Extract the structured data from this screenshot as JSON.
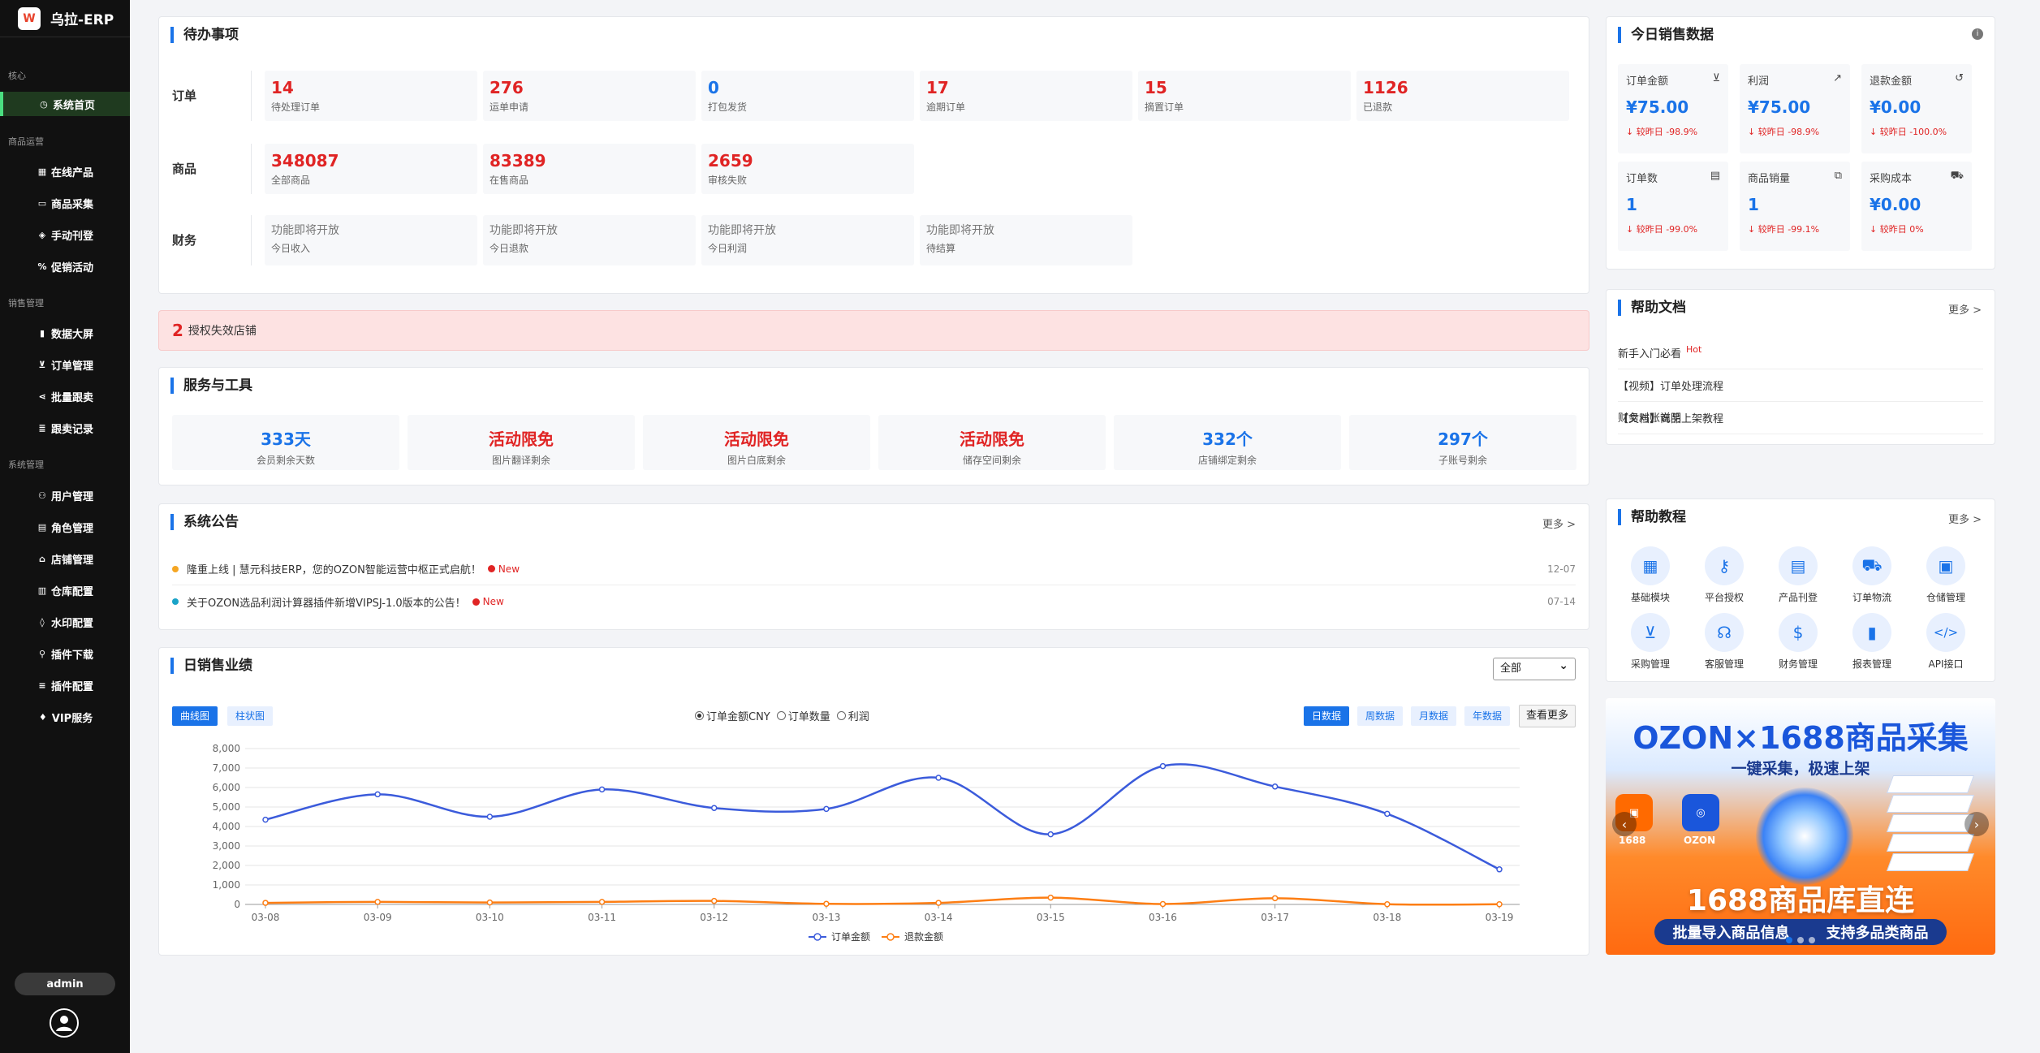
{
  "app": {
    "logo_text": "W",
    "title": "乌拉-ERP"
  },
  "nav": {
    "sections": [
      {
        "label": "核心"
      },
      {
        "label": "商品运营"
      },
      {
        "label": "销售管理"
      },
      {
        "label": "系统管理"
      }
    ],
    "items": [
      {
        "label": "系统首页",
        "icon": "dashboard-icon",
        "glyph": "◷"
      },
      {
        "label": "在线产品",
        "icon": "grid-icon",
        "glyph": "▦"
      },
      {
        "label": "商品采集",
        "icon": "box-icon",
        "glyph": "▭"
      },
      {
        "label": "手动刊登",
        "icon": "upload-icon",
        "glyph": "◈"
      },
      {
        "label": "促销活动",
        "icon": "percent-icon",
        "glyph": "%"
      },
      {
        "label": "数据大屏",
        "icon": "chart-bars-icon",
        "glyph": "▮"
      },
      {
        "label": "订单管理",
        "icon": "cart-icon",
        "glyph": "⊻"
      },
      {
        "label": "批量跟卖",
        "icon": "share-icon",
        "glyph": "⋖"
      },
      {
        "label": "跟卖记录",
        "icon": "list-icon",
        "glyph": "≣"
      },
      {
        "label": "用户管理",
        "icon": "users-icon",
        "glyph": "⚇"
      },
      {
        "label": "角色管理",
        "icon": "id-card-icon",
        "glyph": "▤"
      },
      {
        "label": "店铺管理",
        "icon": "store-icon",
        "glyph": "⌂"
      },
      {
        "label": "仓库配置",
        "icon": "warehouse-icon",
        "glyph": "▥"
      },
      {
        "label": "水印配置",
        "icon": "droplet-icon",
        "glyph": "◊"
      },
      {
        "label": "插件下载",
        "icon": "plug-icon",
        "glyph": "⚲"
      },
      {
        "label": "插件配置",
        "icon": "sliders-icon",
        "glyph": "≡"
      },
      {
        "label": "VIP服务",
        "icon": "crown-icon",
        "glyph": "♦"
      }
    ],
    "user": {
      "name": "admin",
      "avatar_icon": "user-circle-icon"
    }
  },
  "todo": {
    "title": "待办事项",
    "rows": [
      {
        "label": "订单",
        "items": [
          {
            "value": "14",
            "label": "待处理订单",
            "color": "red"
          },
          {
            "value": "276",
            "label": "运单申请",
            "color": "red"
          },
          {
            "value": "0",
            "label": "打包发货",
            "color": "blue"
          },
          {
            "value": "17",
            "label": "逾期订单",
            "color": "red"
          },
          {
            "value": "15",
            "label": "摘置订单",
            "color": "red"
          },
          {
            "value": "1126",
            "label": "已退款",
            "color": "red"
          }
        ]
      },
      {
        "label": "商品",
        "items": [
          {
            "value": "348087",
            "label": "全部商品",
            "color": "red"
          },
          {
            "value": "83389",
            "label": "在售商品",
            "color": "red"
          },
          {
            "value": "2659",
            "label": "审核失败",
            "color": "red"
          }
        ]
      },
      {
        "label": "财务",
        "items": [
          {
            "value": "功能即将开放",
            "label": "今日收入",
            "color": "gray"
          },
          {
            "value": "功能即将开放",
            "label": "今日退款",
            "color": "gray"
          },
          {
            "value": "功能即将开放",
            "label": "今日利润",
            "color": "gray"
          },
          {
            "value": "功能即将开放",
            "label": "待结算",
            "color": "gray"
          }
        ]
      }
    ]
  },
  "alert": {
    "count": "2",
    "text": "授权失效店铺"
  },
  "services": {
    "title": "服务与工具",
    "items": [
      {
        "value": "333天",
        "label": "会员剩余天数",
        "color": "blue"
      },
      {
        "value": "活动限免",
        "label": "图片翻译剩余",
        "color": "red"
      },
      {
        "value": "活动限免",
        "label": "图片白底剩余",
        "color": "red"
      },
      {
        "value": "活动限免",
        "label": "储存空间剩余",
        "color": "red"
      },
      {
        "value": "332个",
        "label": "店铺绑定剩余",
        "color": "blue"
      },
      {
        "value": "297个",
        "label": "子账号剩余",
        "color": "blue"
      }
    ]
  },
  "notices": {
    "title": "系统公告",
    "more": "更多 >",
    "items": [
      {
        "text": "隆重上线 | 慧元科技ERP，您的OZON智能运营中枢正式启航！",
        "badge": "New",
        "date": "12-07",
        "dot": "#f5a623"
      },
      {
        "text": "关于OZON选品利润计算器插件新增VIPSJ-1.0版本的公告！",
        "badge": "New",
        "date": "07-14",
        "dot": "#1aa3c8"
      }
    ]
  },
  "sales": {
    "title": "日销售业绩",
    "filter": "全部",
    "chart_tabs": [
      "曲线图",
      "柱状图"
    ],
    "radios": [
      {
        "label": "订单金额CNY",
        "checked": true
      },
      {
        "label": "订单数量",
        "checked": false
      },
      {
        "label": "利润",
        "checked": false
      }
    ],
    "period_tabs": [
      "日数据",
      "周数据",
      "月数据",
      "年数据"
    ],
    "view_more": "查看更多"
  },
  "chart_data": {
    "type": "line",
    "x": [
      "03-08",
      "03-09",
      "03-10",
      "03-11",
      "03-12",
      "03-13",
      "03-14",
      "03-15",
      "03-16",
      "03-17",
      "03-18",
      "03-19"
    ],
    "series": [
      {
        "name": "订单金额",
        "color": "#3b5bdb",
        "values": [
          4350,
          5650,
          4500,
          5900,
          4950,
          4900,
          6500,
          3600,
          7100,
          6050,
          4650,
          1800
        ]
      },
      {
        "name": "退款金额",
        "color": "#fd7e14",
        "values": [
          80,
          130,
          100,
          130,
          180,
          30,
          80,
          350,
          20,
          320,
          10,
          10
        ]
      }
    ],
    "ylim": [
      0,
      8000
    ],
    "yticks": [
      "0",
      "1,000",
      "2,000",
      "3,000",
      "4,000",
      "5,000",
      "6,000",
      "7,000",
      "8,000"
    ],
    "grid": true,
    "legend": "bottom"
  },
  "today_sales": {
    "title": "今日销售数据",
    "info_icon": "info-icon",
    "metrics": [
      {
        "title": "订单金额",
        "value": "¥75.00",
        "change": "↓ 较昨日 -98.9%",
        "icon": "cart-icon",
        "glyph": "🛒"
      },
      {
        "title": "利润",
        "value": "¥75.00",
        "change": "↓ 较昨日 -98.9%",
        "icon": "trend-icon",
        "glyph": "📈"
      },
      {
        "title": "退款金额",
        "value": "¥0.00",
        "change": "↓ 较昨日 -100.0%",
        "icon": "refresh-icon",
        "glyph": "↺"
      },
      {
        "title": "订单数",
        "value": "1",
        "change": "↓ 较昨日 -99.0%",
        "icon": "file-icon",
        "glyph": "▤"
      },
      {
        "title": "商品销量",
        "value": "1",
        "change": "↓ 较昨日 -99.1%",
        "icon": "boxes-icon",
        "glyph": "⧉"
      },
      {
        "title": "采购成本",
        "value": "¥0.00",
        "change": "↓ 较昨日 0%",
        "icon": "truck-icon",
        "glyph": "⛟"
      }
    ]
  },
  "help_docs": {
    "title": "帮助文档",
    "more": "更多 >",
    "items": [
      {
        "text": "新手入门必看",
        "hot": "Hot"
      },
      {
        "text": "【视频】订单处理流程",
        "hot": ""
      },
      {
        "text": "【文档】商品上架教程",
        "hot": ""
      },
      {
        "text": "财务对账说明",
        "hot": ""
      }
    ]
  },
  "tutorials": {
    "title": "帮助教程",
    "more": "更多 >",
    "items": [
      {
        "label": "基础模块",
        "icon": "grid-icon",
        "glyph": "▦"
      },
      {
        "label": "平台授权",
        "icon": "key-icon",
        "glyph": "⚷"
      },
      {
        "label": "产品刊登",
        "icon": "document-icon",
        "glyph": "▤"
      },
      {
        "label": "订单物流",
        "icon": "truck-icon",
        "glyph": "⛟"
      },
      {
        "label": "仓储管理",
        "icon": "archive-icon",
        "glyph": "▣"
      },
      {
        "label": "采购管理",
        "icon": "cart-icon",
        "glyph": "⊻"
      },
      {
        "label": "客服管理",
        "icon": "headset-icon",
        "glyph": "☊"
      },
      {
        "label": "财务管理",
        "icon": "money-icon",
        "glyph": "$"
      },
      {
        "label": "报表管理",
        "icon": "chart-icon",
        "glyph": "▮"
      },
      {
        "label": "API接口",
        "icon": "code-icon",
        "glyph": "</>"
      }
    ]
  },
  "banner": {
    "headline": "OZON×1688商品采集",
    "subline": "一键采集，极速上架",
    "logo_a": "1688",
    "logo_b": "OZON",
    "main_text": "1688商品库直连",
    "pill_left": "批量导入商品信息",
    "pill_right": "支持多品类商品",
    "prev_icon": "chevron-left-icon",
    "next_icon": "chevron-right-icon"
  }
}
